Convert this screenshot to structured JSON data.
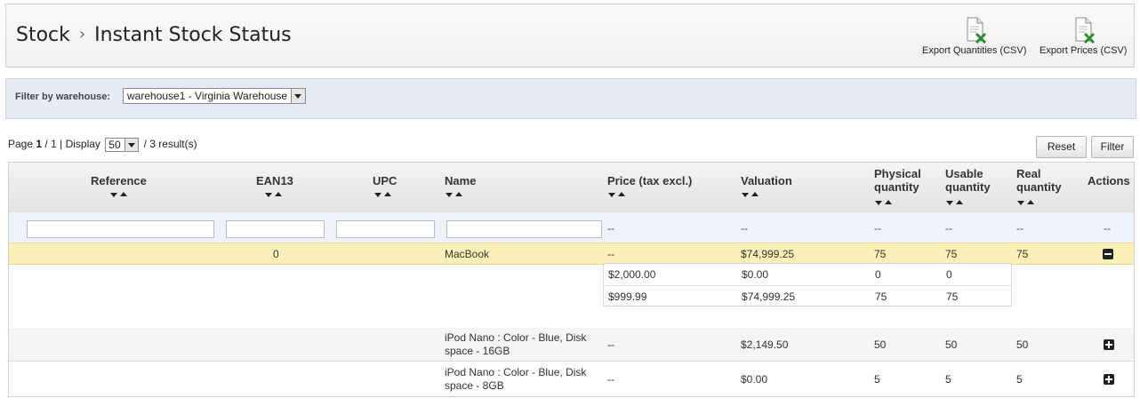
{
  "header": {
    "breadcrumb_parent": "Stock",
    "breadcrumb_separator": "›",
    "breadcrumb_current": "Instant Stock Status",
    "export_quantities_label": "Export Quantities (CSV)",
    "export_prices_label": "Export Prices (CSV)"
  },
  "filter": {
    "label": "Filter by warehouse:",
    "warehouse_value": "warehouse1 - Virginia Warehouse"
  },
  "pagination": {
    "page_prefix": "Page",
    "page_current": "1",
    "page_sep": "/",
    "page_total": "1",
    "display_label": "| Display",
    "per_page": "50",
    "results_text": "/ 3 result(s)"
  },
  "buttons": {
    "reset": "Reset",
    "filter": "Filter"
  },
  "table": {
    "headers": {
      "reference": "Reference",
      "ean13": "EAN13",
      "upc": "UPC",
      "name": "Name",
      "price": "Price (tax excl.)",
      "valuation": "Valuation",
      "physical_1": "Physical",
      "physical_2": "quantity",
      "usable_1": "Usable",
      "usable_2": "quantity",
      "real_1": "Real",
      "real_2": "quantity",
      "actions": "Actions"
    },
    "filter_row": {
      "price": "--",
      "valuation": "--",
      "physical": "--",
      "usable": "--",
      "real": "--",
      "actions": "--"
    },
    "rows": [
      {
        "reference": "",
        "ean13": "0",
        "upc": "",
        "name": "MacBook",
        "price": "--",
        "valuation": "$74,999.25",
        "physical": "75",
        "usable": "75",
        "real": "75",
        "action": "collapse",
        "details": [
          {
            "price": "$2,000.00",
            "valuation": "$0.00",
            "physical": "0",
            "usable": "0"
          },
          {
            "price": "$999.99",
            "valuation": "$74,999.25",
            "physical": "75",
            "usable": "75"
          }
        ]
      },
      {
        "reference": "",
        "ean13": "",
        "upc": "",
        "name_line1": "iPod Nano : Color - Blue, Disk",
        "name_line2": "space - 16GB",
        "price": "--",
        "valuation": "$2,149.50",
        "physical": "50",
        "usable": "50",
        "real": "50",
        "action": "expand"
      },
      {
        "reference": "",
        "ean13": "",
        "upc": "",
        "name_line1": "iPod Nano : Color - Blue, Disk",
        "name_line2": "space - 8GB",
        "price": "--",
        "valuation": "$0.00",
        "physical": "5",
        "usable": "5",
        "real": "5",
        "action": "expand"
      }
    ]
  },
  "colors": {
    "highlight_row": "#fbf0b7",
    "filter_bar": "#e8ebf5",
    "excel_icon": "#2e8b2e"
  },
  "icons": {
    "export_quantities": "excel-file-icon",
    "export_prices": "excel-file-icon",
    "collapse": "minus-square-icon",
    "expand": "plus-square-icon"
  }
}
